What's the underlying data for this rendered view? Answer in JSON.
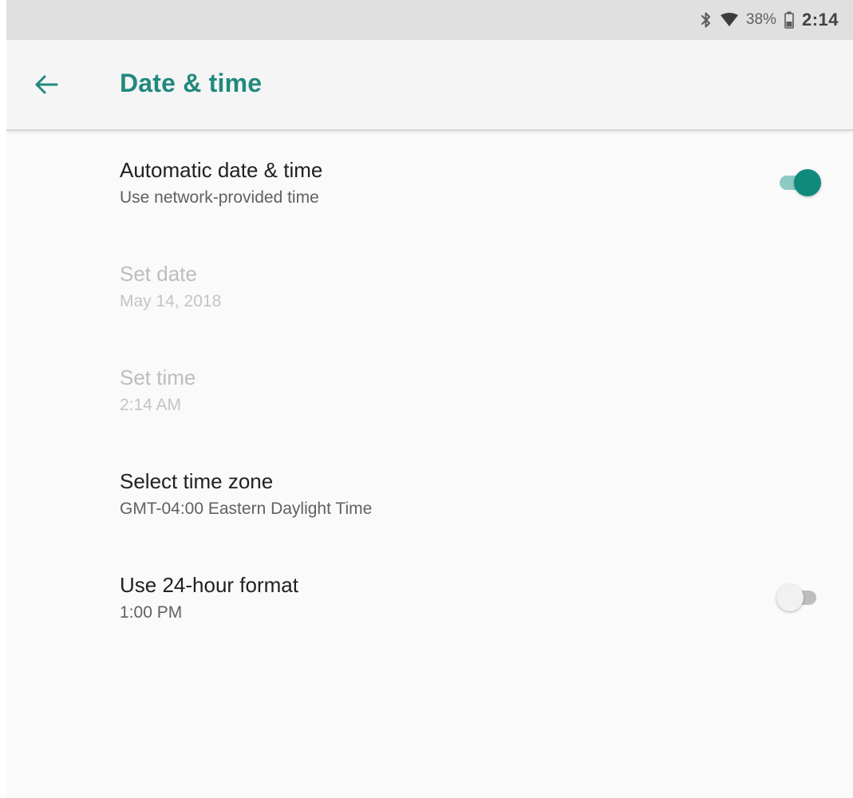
{
  "status_bar": {
    "bluetooth_icon": "bluetooth-icon",
    "wifi_icon": "wifi-icon",
    "battery_percent": "38%",
    "battery_icon": "battery-icon",
    "clock": "2:14"
  },
  "app_bar": {
    "back_icon": "arrow-back-icon",
    "title": "Date & time"
  },
  "settings": [
    {
      "title": "Automatic date & time",
      "summary": "Use network-provided time",
      "enabled": true,
      "control": "switch",
      "checked": true
    },
    {
      "title": "Set date",
      "summary": "May 14, 2018",
      "enabled": false
    },
    {
      "title": "Set time",
      "summary": "2:14 AM",
      "enabled": false
    },
    {
      "title": "Select time zone",
      "summary": "GMT-04:00 Eastern Daylight Time",
      "enabled": true
    },
    {
      "title": "Use 24-hour format",
      "summary": "1:00 PM",
      "enabled": true,
      "control": "switch",
      "checked": false
    }
  ],
  "colors": {
    "accent": "#0f8a7c",
    "title": "#21897e",
    "status_bar_bg": "#e0e0e0",
    "app_bar_bg": "#f5f5f5",
    "background": "#fafafa"
  }
}
